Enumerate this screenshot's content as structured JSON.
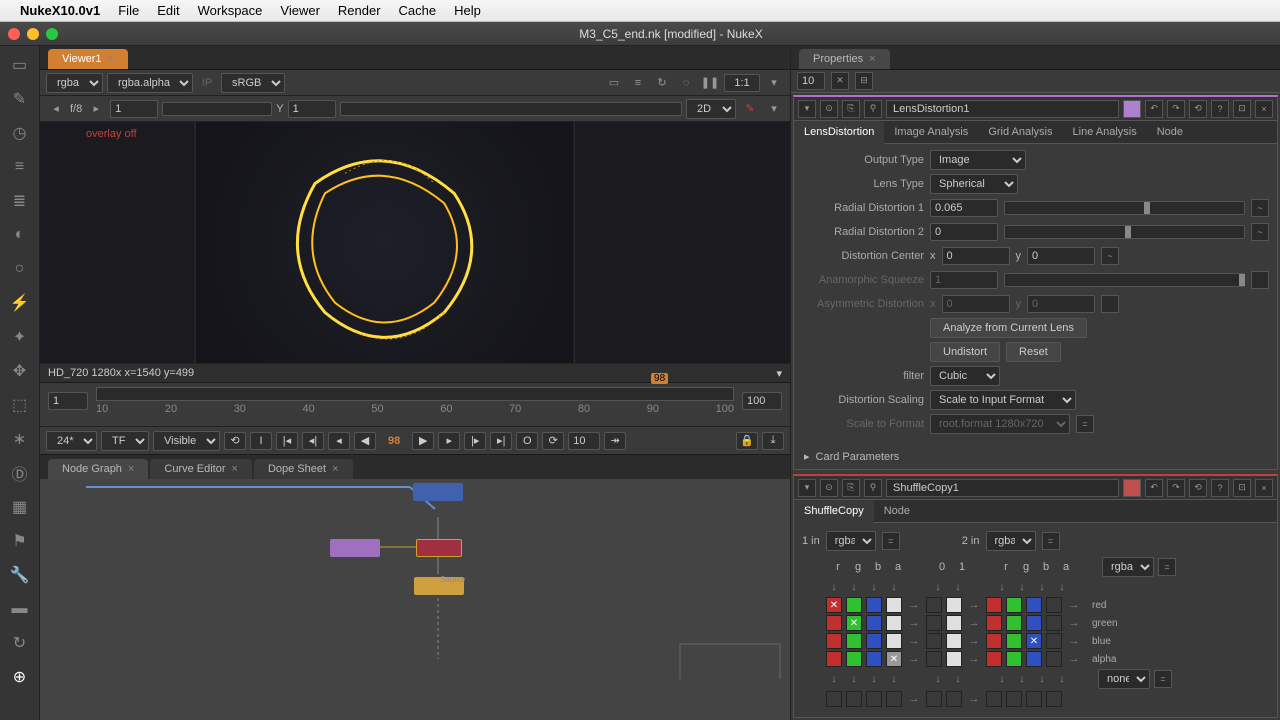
{
  "menubar": {
    "app_name": "NukeX10.0v1",
    "items": [
      "File",
      "Edit",
      "Workspace",
      "Viewer",
      "Render",
      "Cache",
      "Help"
    ]
  },
  "window_title": "M3_C5_end.nk [modified] - NukeX",
  "viewer_tab": "Viewer1",
  "viewer_toolbar": {
    "channel": "rgba",
    "alpha": "rgba.alpha",
    "ip": "IP",
    "colorspace": "sRGB",
    "ratio": "1:1"
  },
  "playbar": {
    "fstop": "f/8",
    "frame_a": "1",
    "y": "Y",
    "frame_y": "1",
    "mode": "2D"
  },
  "overlay_text": "overlay off",
  "status": "HD_720 1280x   x=1540 y=499",
  "timeline": {
    "start": "1",
    "end": "100",
    "cursor": "98",
    "out": "100",
    "tick_labels": [
      "10",
      "20",
      "30",
      "40",
      "50",
      "60",
      "70",
      "80",
      "90",
      "100"
    ]
  },
  "playback": {
    "fps": "24*",
    "tf": "TF",
    "visible": "Visible",
    "frame": "98",
    "range": "10"
  },
  "bottom_tabs": [
    "Node Graph",
    "Curve Editor",
    "Dope Sheet"
  ],
  "nodegraph_label": "Source",
  "properties": {
    "title": "Properties",
    "count": "10",
    "lens": {
      "name": "LensDistortion1",
      "tabs": [
        "LensDistortion",
        "Image Analysis",
        "Grid Analysis",
        "Line Analysis",
        "Node"
      ],
      "output_type_label": "Output Type",
      "output_type": "Image",
      "lens_type_label": "Lens Type",
      "lens_type": "Spherical",
      "rad1_label": "Radial Distortion 1",
      "rad1": "0.065",
      "rad2_label": "Radial Distortion 2",
      "rad2": "0",
      "center_label": "Distortion Center",
      "center_x_lbl": "x",
      "center_x": "0",
      "center_y_lbl": "y",
      "center_y": "0",
      "anamorphic_label": "Anamorphic Squeeze",
      "anamorphic": "1",
      "asym_label": "Asymmetric Distortion",
      "asym_x_lbl": "x",
      "asym_x": "0",
      "asym_y_lbl": "y",
      "asym_y": "0",
      "analyze_btn": "Analyze from Current Lens",
      "undistort_btn": "Undistort",
      "reset_btn": "Reset",
      "filter_label": "filter",
      "filter": "Cubic",
      "scaling_label": "Distortion Scaling",
      "scaling": "Scale to Input Format",
      "scale_fmt_label": "Scale to Format",
      "scale_fmt": "root.format 1280x720",
      "card_params": "Card Parameters"
    },
    "shuffle": {
      "name": "ShuffleCopy1",
      "tabs": [
        "ShuffleCopy",
        "Node"
      ],
      "in1_label": "1 in",
      "in1": "rgba",
      "in2_label": "2 in",
      "in2": "rgba",
      "ch_labels": [
        "r",
        "g",
        "b",
        "a",
        "0",
        "1",
        "r",
        "g",
        "b",
        "a"
      ],
      "out_select": "rgba",
      "none_select": "none",
      "out_labels": [
        "red",
        "green",
        "blue",
        "alpha"
      ]
    }
  }
}
